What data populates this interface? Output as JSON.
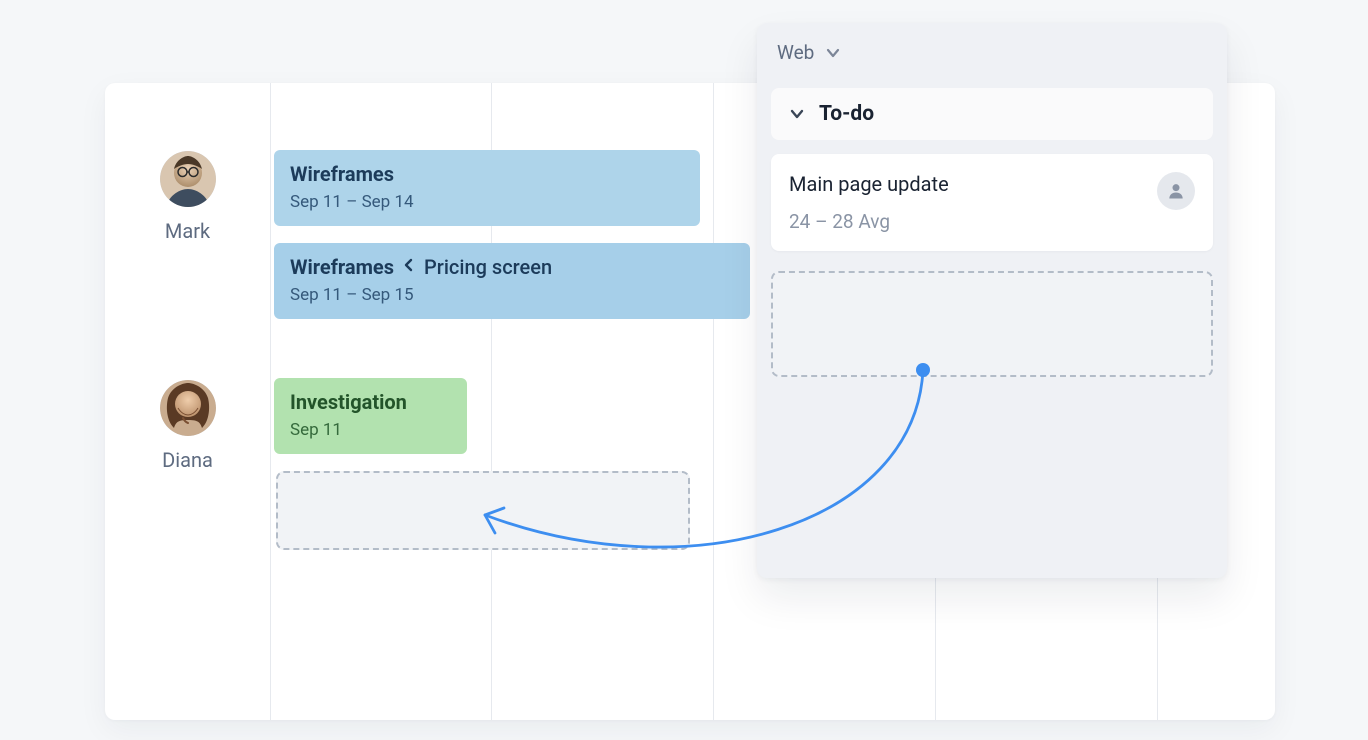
{
  "timeline": {
    "people": [
      {
        "name": "Mark"
      },
      {
        "name": "Diana"
      }
    ],
    "tasks": [
      {
        "title": "Wireframes",
        "date_label": "Sep 11 – Sep 14",
        "parent": null
      },
      {
        "title": "Wireframes",
        "date_label": "Sep 11 – Sep 15",
        "parent": "Pricing screen"
      },
      {
        "title": "Investigation",
        "date_label": "Sep 11",
        "parent": null
      }
    ]
  },
  "panel": {
    "header_label": "Web",
    "section_label": "To-do",
    "card": {
      "title": "Main page update",
      "date_label": "24 – 28 Avg"
    }
  }
}
